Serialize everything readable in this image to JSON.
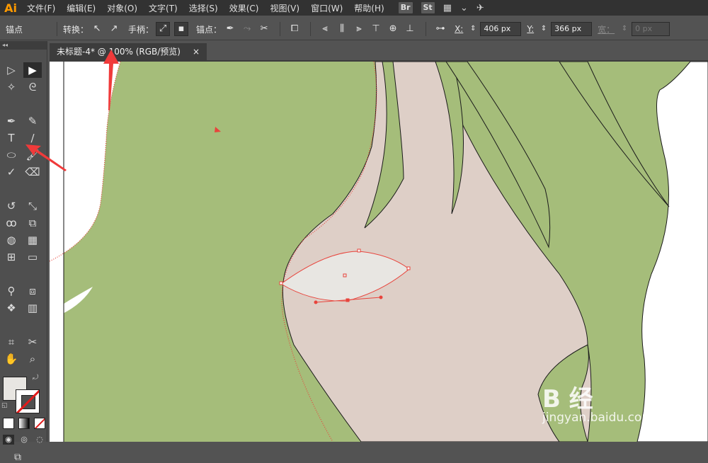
{
  "app": {
    "logo": "Ai"
  },
  "menu": {
    "items": [
      "文件(F)",
      "编辑(E)",
      "对象(O)",
      "文字(T)",
      "选择(S)",
      "效果(C)",
      "视图(V)",
      "窗口(W)",
      "帮助(H)"
    ],
    "badges": [
      "Br",
      "St"
    ],
    "misc_icons": [
      "workspace-grid-icon",
      "chevron-down-icon",
      "gpu-icon"
    ]
  },
  "control_bar": {
    "panel_title": "锚点",
    "convert_label": "转换：",
    "handles_label": "手柄：",
    "anchors_label": "锚点：",
    "x_label": "X:",
    "x_value": "406 px",
    "y_label": "Y:",
    "y_value": "366 px",
    "w_label": "宽：",
    "w_value": "0 px"
  },
  "document": {
    "tab_title": "未标题-4* @ 100% (RGB/预览)",
    "close_glyph": "×"
  },
  "tools": [
    {
      "name": "selection-tool",
      "glyph": "▷"
    },
    {
      "name": "direct-selection-tool",
      "glyph": "▶",
      "active": true
    },
    {
      "name": "magic-wand-tool",
      "glyph": "✧"
    },
    {
      "name": "lasso-tool",
      "glyph": "ᘓ"
    },
    {
      "name": "pen-tool",
      "glyph": "✒"
    },
    {
      "name": "curvature-tool",
      "glyph": "✎"
    },
    {
      "name": "type-tool",
      "glyph": "T"
    },
    {
      "name": "line-segment-tool",
      "glyph": "∕"
    },
    {
      "name": "ellipse-tool",
      "glyph": "⬭"
    },
    {
      "name": "paintbrush-tool",
      "glyph": "🖌"
    },
    {
      "name": "shaper-tool",
      "glyph": "✓"
    },
    {
      "name": "eraser-tool",
      "glyph": "⌫"
    },
    {
      "name": "rotate-tool",
      "glyph": "↺"
    },
    {
      "name": "scale-tool",
      "glyph": "⤡"
    },
    {
      "name": "warp-tool",
      "glyph": "ꝏ"
    },
    {
      "name": "free-transform-tool",
      "glyph": "⧉"
    },
    {
      "name": "shape-builder-tool",
      "glyph": "◍"
    },
    {
      "name": "perspective-grid-tool",
      "glyph": "▦"
    },
    {
      "name": "mesh-tool",
      "glyph": "⊞"
    },
    {
      "name": "gradient-tool",
      "glyph": "▭"
    },
    {
      "name": "eyedropper-tool",
      "glyph": "⚲"
    },
    {
      "name": "blend-tool",
      "glyph": "⧈"
    },
    {
      "name": "symbol-sprayer-tool",
      "glyph": "❖"
    },
    {
      "name": "column-graph-tool",
      "glyph": "▥"
    },
    {
      "name": "artboard-tool",
      "glyph": "⌗"
    },
    {
      "name": "slice-tool",
      "glyph": "✂"
    },
    {
      "name": "hand-tool",
      "glyph": "✋"
    },
    {
      "name": "zoom-tool",
      "glyph": "⌕"
    }
  ],
  "colors": {
    "fill": "#e8e6e2",
    "stroke": "none",
    "hair": "#a5bd7a",
    "skin": "#decfc7",
    "eye": "#e8e6e2",
    "selection": "#e8443c",
    "annotation_arrow": "#f03a3a"
  },
  "watermark": {
    "big": "B    经",
    "small": "jingyan.baidu.com"
  }
}
